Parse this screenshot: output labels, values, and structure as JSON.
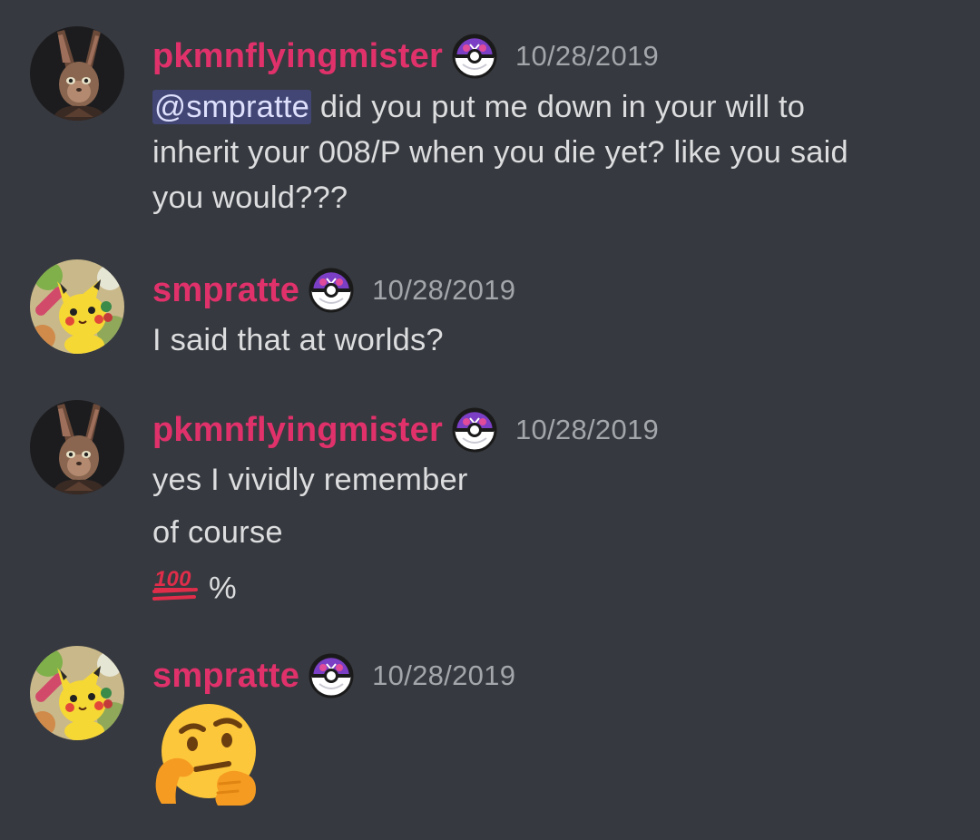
{
  "colors": {
    "background": "#36393f",
    "username": "#e0316b",
    "text": "#dcddde",
    "timestamp": "#a3a6aa",
    "mention_bg": "#414675",
    "mention_text": "#dee0fc"
  },
  "messages": [
    {
      "author": "pkmnflyingmister",
      "avatar_icon": "rabbit-avatar-icon",
      "badge_icon": "master-ball-badge-icon",
      "timestamp": "10/28/2019",
      "mention": "@smpratte",
      "lines": [
        "did you put me down in your will to",
        "inherit your 008/P when you die yet? like you said",
        "you would???"
      ]
    },
    {
      "author": "smpratte",
      "avatar_icon": "pikachu-avatar-icon",
      "badge_icon": "master-ball-badge-icon",
      "timestamp": "10/28/2019",
      "lines": [
        "I said that at worlds?"
      ]
    },
    {
      "author": "pkmnflyingmister",
      "avatar_icon": "rabbit-avatar-icon",
      "badge_icon": "master-ball-badge-icon",
      "timestamp": "10/28/2019",
      "lines": [
        "yes I vividly remember",
        "of course",
        "%"
      ],
      "emoji": "hundred-points-emoji"
    },
    {
      "author": "smpratte",
      "avatar_icon": "pikachu-avatar-icon",
      "badge_icon": "master-ball-badge-icon",
      "timestamp": "10/28/2019",
      "emoji": "thinking-face-emoji"
    }
  ]
}
